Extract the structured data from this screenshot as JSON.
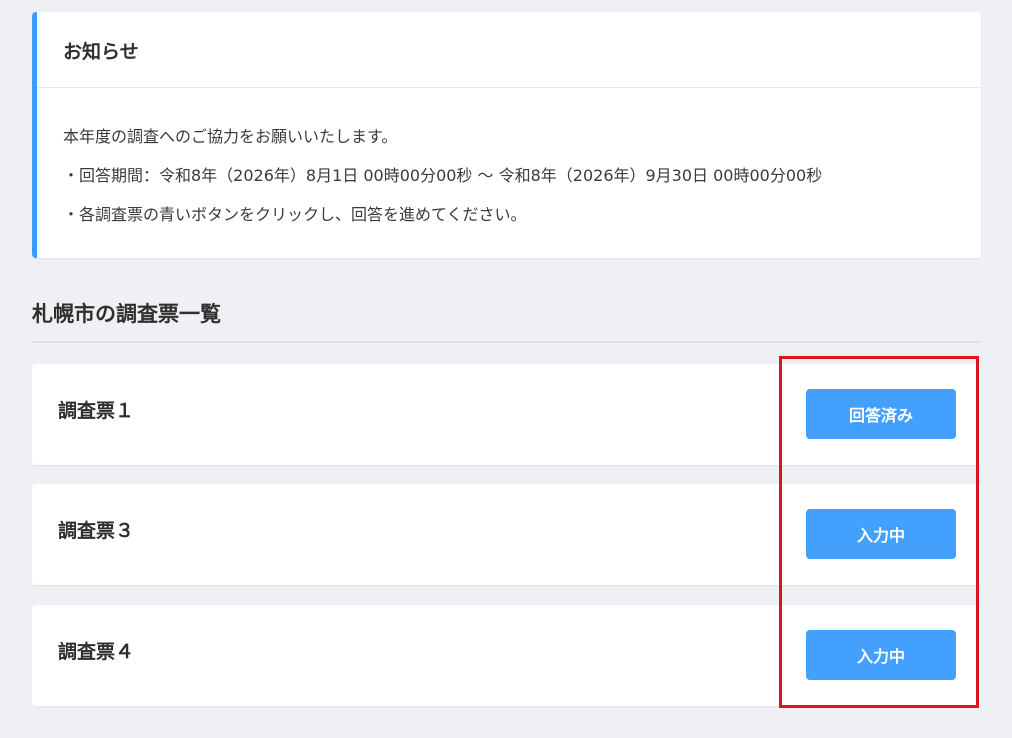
{
  "notice": {
    "title": "お知らせ",
    "lines": [
      "本年度の調査へのご協力をお願いいたします。",
      "・回答期間：令和8年（2026年）8月1日 00時00分00秒 〜 令和8年（2026年）9月30日 00時00分00秒",
      "・各調査票の青いボタンをクリックし、回答を進めてください。"
    ],
    "accent_color": "#3d9bfb"
  },
  "survey_list": {
    "title": "札幌市の調査票一覧",
    "items": [
      {
        "name": "調査票１",
        "button_label": "回答済み"
      },
      {
        "name": "調査票３",
        "button_label": "入力中"
      },
      {
        "name": "調査票４",
        "button_label": "入力中"
      }
    ]
  },
  "colors": {
    "button": "#43a0fc",
    "highlight": "#e0121b",
    "background": "#eff0f4"
  }
}
